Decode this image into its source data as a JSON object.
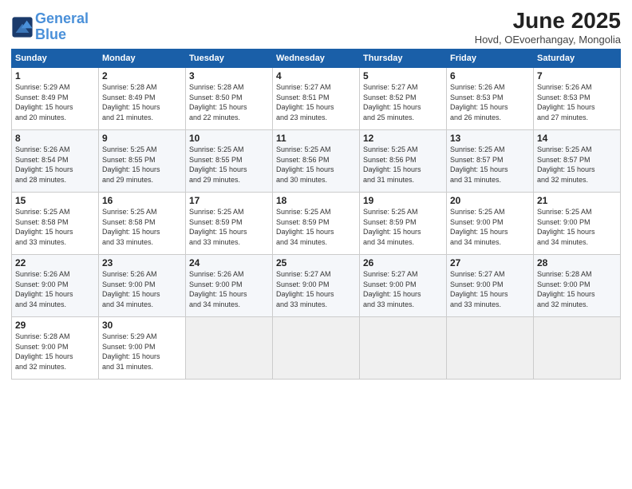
{
  "logo": {
    "line1": "General",
    "line2": "Blue"
  },
  "title": "June 2025",
  "subtitle": "Hovd, OEvoerhangay, Mongolia",
  "headers": [
    "Sunday",
    "Monday",
    "Tuesday",
    "Wednesday",
    "Thursday",
    "Friday",
    "Saturday"
  ],
  "weeks": [
    [
      {
        "day": "1",
        "info": "Sunrise: 5:29 AM\nSunset: 8:49 PM\nDaylight: 15 hours\nand 20 minutes."
      },
      {
        "day": "2",
        "info": "Sunrise: 5:28 AM\nSunset: 8:49 PM\nDaylight: 15 hours\nand 21 minutes."
      },
      {
        "day": "3",
        "info": "Sunrise: 5:28 AM\nSunset: 8:50 PM\nDaylight: 15 hours\nand 22 minutes."
      },
      {
        "day": "4",
        "info": "Sunrise: 5:27 AM\nSunset: 8:51 PM\nDaylight: 15 hours\nand 23 minutes."
      },
      {
        "day": "5",
        "info": "Sunrise: 5:27 AM\nSunset: 8:52 PM\nDaylight: 15 hours\nand 25 minutes."
      },
      {
        "day": "6",
        "info": "Sunrise: 5:26 AM\nSunset: 8:53 PM\nDaylight: 15 hours\nand 26 minutes."
      },
      {
        "day": "7",
        "info": "Sunrise: 5:26 AM\nSunset: 8:53 PM\nDaylight: 15 hours\nand 27 minutes."
      }
    ],
    [
      {
        "day": "8",
        "info": "Sunrise: 5:26 AM\nSunset: 8:54 PM\nDaylight: 15 hours\nand 28 minutes."
      },
      {
        "day": "9",
        "info": "Sunrise: 5:25 AM\nSunset: 8:55 PM\nDaylight: 15 hours\nand 29 minutes."
      },
      {
        "day": "10",
        "info": "Sunrise: 5:25 AM\nSunset: 8:55 PM\nDaylight: 15 hours\nand 29 minutes."
      },
      {
        "day": "11",
        "info": "Sunrise: 5:25 AM\nSunset: 8:56 PM\nDaylight: 15 hours\nand 30 minutes."
      },
      {
        "day": "12",
        "info": "Sunrise: 5:25 AM\nSunset: 8:56 PM\nDaylight: 15 hours\nand 31 minutes."
      },
      {
        "day": "13",
        "info": "Sunrise: 5:25 AM\nSunset: 8:57 PM\nDaylight: 15 hours\nand 31 minutes."
      },
      {
        "day": "14",
        "info": "Sunrise: 5:25 AM\nSunset: 8:57 PM\nDaylight: 15 hours\nand 32 minutes."
      }
    ],
    [
      {
        "day": "15",
        "info": "Sunrise: 5:25 AM\nSunset: 8:58 PM\nDaylight: 15 hours\nand 33 minutes."
      },
      {
        "day": "16",
        "info": "Sunrise: 5:25 AM\nSunset: 8:58 PM\nDaylight: 15 hours\nand 33 minutes."
      },
      {
        "day": "17",
        "info": "Sunrise: 5:25 AM\nSunset: 8:59 PM\nDaylight: 15 hours\nand 33 minutes."
      },
      {
        "day": "18",
        "info": "Sunrise: 5:25 AM\nSunset: 8:59 PM\nDaylight: 15 hours\nand 34 minutes."
      },
      {
        "day": "19",
        "info": "Sunrise: 5:25 AM\nSunset: 8:59 PM\nDaylight: 15 hours\nand 34 minutes."
      },
      {
        "day": "20",
        "info": "Sunrise: 5:25 AM\nSunset: 9:00 PM\nDaylight: 15 hours\nand 34 minutes."
      },
      {
        "day": "21",
        "info": "Sunrise: 5:25 AM\nSunset: 9:00 PM\nDaylight: 15 hours\nand 34 minutes."
      }
    ],
    [
      {
        "day": "22",
        "info": "Sunrise: 5:26 AM\nSunset: 9:00 PM\nDaylight: 15 hours\nand 34 minutes."
      },
      {
        "day": "23",
        "info": "Sunrise: 5:26 AM\nSunset: 9:00 PM\nDaylight: 15 hours\nand 34 minutes."
      },
      {
        "day": "24",
        "info": "Sunrise: 5:26 AM\nSunset: 9:00 PM\nDaylight: 15 hours\nand 34 minutes."
      },
      {
        "day": "25",
        "info": "Sunrise: 5:27 AM\nSunset: 9:00 PM\nDaylight: 15 hours\nand 33 minutes."
      },
      {
        "day": "26",
        "info": "Sunrise: 5:27 AM\nSunset: 9:00 PM\nDaylight: 15 hours\nand 33 minutes."
      },
      {
        "day": "27",
        "info": "Sunrise: 5:27 AM\nSunset: 9:00 PM\nDaylight: 15 hours\nand 33 minutes."
      },
      {
        "day": "28",
        "info": "Sunrise: 5:28 AM\nSunset: 9:00 PM\nDaylight: 15 hours\nand 32 minutes."
      }
    ],
    [
      {
        "day": "29",
        "info": "Sunrise: 5:28 AM\nSunset: 9:00 PM\nDaylight: 15 hours\nand 32 minutes."
      },
      {
        "day": "30",
        "info": "Sunrise: 5:29 AM\nSunset: 9:00 PM\nDaylight: 15 hours\nand 31 minutes."
      },
      {
        "day": "",
        "info": ""
      },
      {
        "day": "",
        "info": ""
      },
      {
        "day": "",
        "info": ""
      },
      {
        "day": "",
        "info": ""
      },
      {
        "day": "",
        "info": ""
      }
    ]
  ]
}
